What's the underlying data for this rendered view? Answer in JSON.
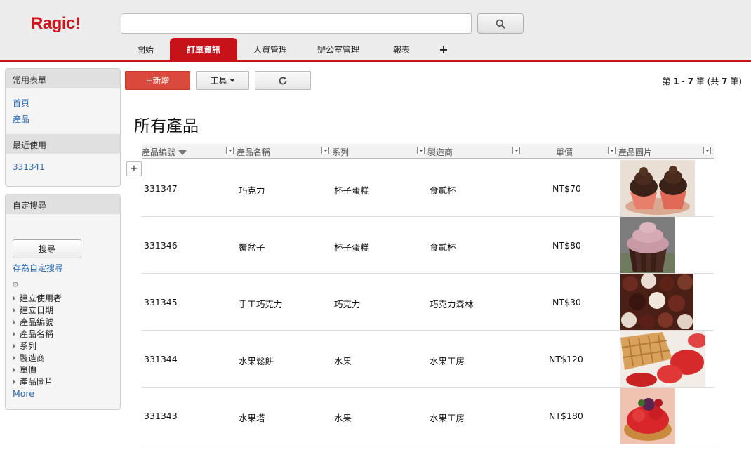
{
  "header": {
    "logo": "Ragic!",
    "search_value": "",
    "tabs": [
      {
        "label": "開始"
      },
      {
        "label": "訂單資訊"
      },
      {
        "label": "人資管理"
      },
      {
        "label": "辦公室管理"
      },
      {
        "label": "報表"
      },
      {
        "label": "+"
      }
    ]
  },
  "sidebar": {
    "favorites": {
      "title": "常用表單",
      "items": [
        "首頁",
        "產品"
      ]
    },
    "recent": {
      "title": "最近使用",
      "items": [
        "331341"
      ]
    },
    "custom_search": {
      "title": "自定搜尋",
      "search_button": "搜尋",
      "save_link": "存為自定搜尋",
      "fields": [
        "建立使用者",
        "建立日期",
        "產品編號",
        "產品名稱",
        "系列",
        "製造商",
        "單價",
        "產品圖片"
      ],
      "more": "More"
    }
  },
  "toolbar": {
    "new_label": "+新增",
    "tools_label": "工具",
    "paging": {
      "prefix": "第 ",
      "from": "1",
      "sep": " - ",
      "to": "7",
      "mid": " 筆 (共 ",
      "total": "7",
      "suffix": " 筆)"
    }
  },
  "main": {
    "title": "所有產品",
    "columns": [
      "產品編號",
      "產品名稱",
      "系列",
      "製造商",
      "單價",
      "產品圖片"
    ],
    "rows": [
      {
        "id": "331347",
        "name": "巧克力",
        "series": "杯子蛋糕",
        "maker": "食貳杯",
        "price": "NT$70",
        "image": "chocolate-cupcakes"
      },
      {
        "id": "331346",
        "name": "覆盆子",
        "series": "杯子蛋糕",
        "maker": "食貳杯",
        "price": "NT$80",
        "image": "raspberry-cupcake"
      },
      {
        "id": "331345",
        "name": "手工巧克力",
        "series": "巧克力",
        "maker": "巧克力森林",
        "price": "NT$30",
        "image": "chocolate-truffles"
      },
      {
        "id": "331344",
        "name": "水果鬆餅",
        "series": "水果",
        "maker": "水果工房",
        "price": "NT$120",
        "image": "strawberry-waffle"
      },
      {
        "id": "331343",
        "name": "水果塔",
        "series": "水果",
        "maker": "水果工房",
        "price": "NT$180",
        "image": "fruit-tart"
      }
    ]
  },
  "colors": {
    "brand_red": "#c8121a",
    "new_button": "#d94a3c",
    "link_blue": "#2a6ab8"
  }
}
